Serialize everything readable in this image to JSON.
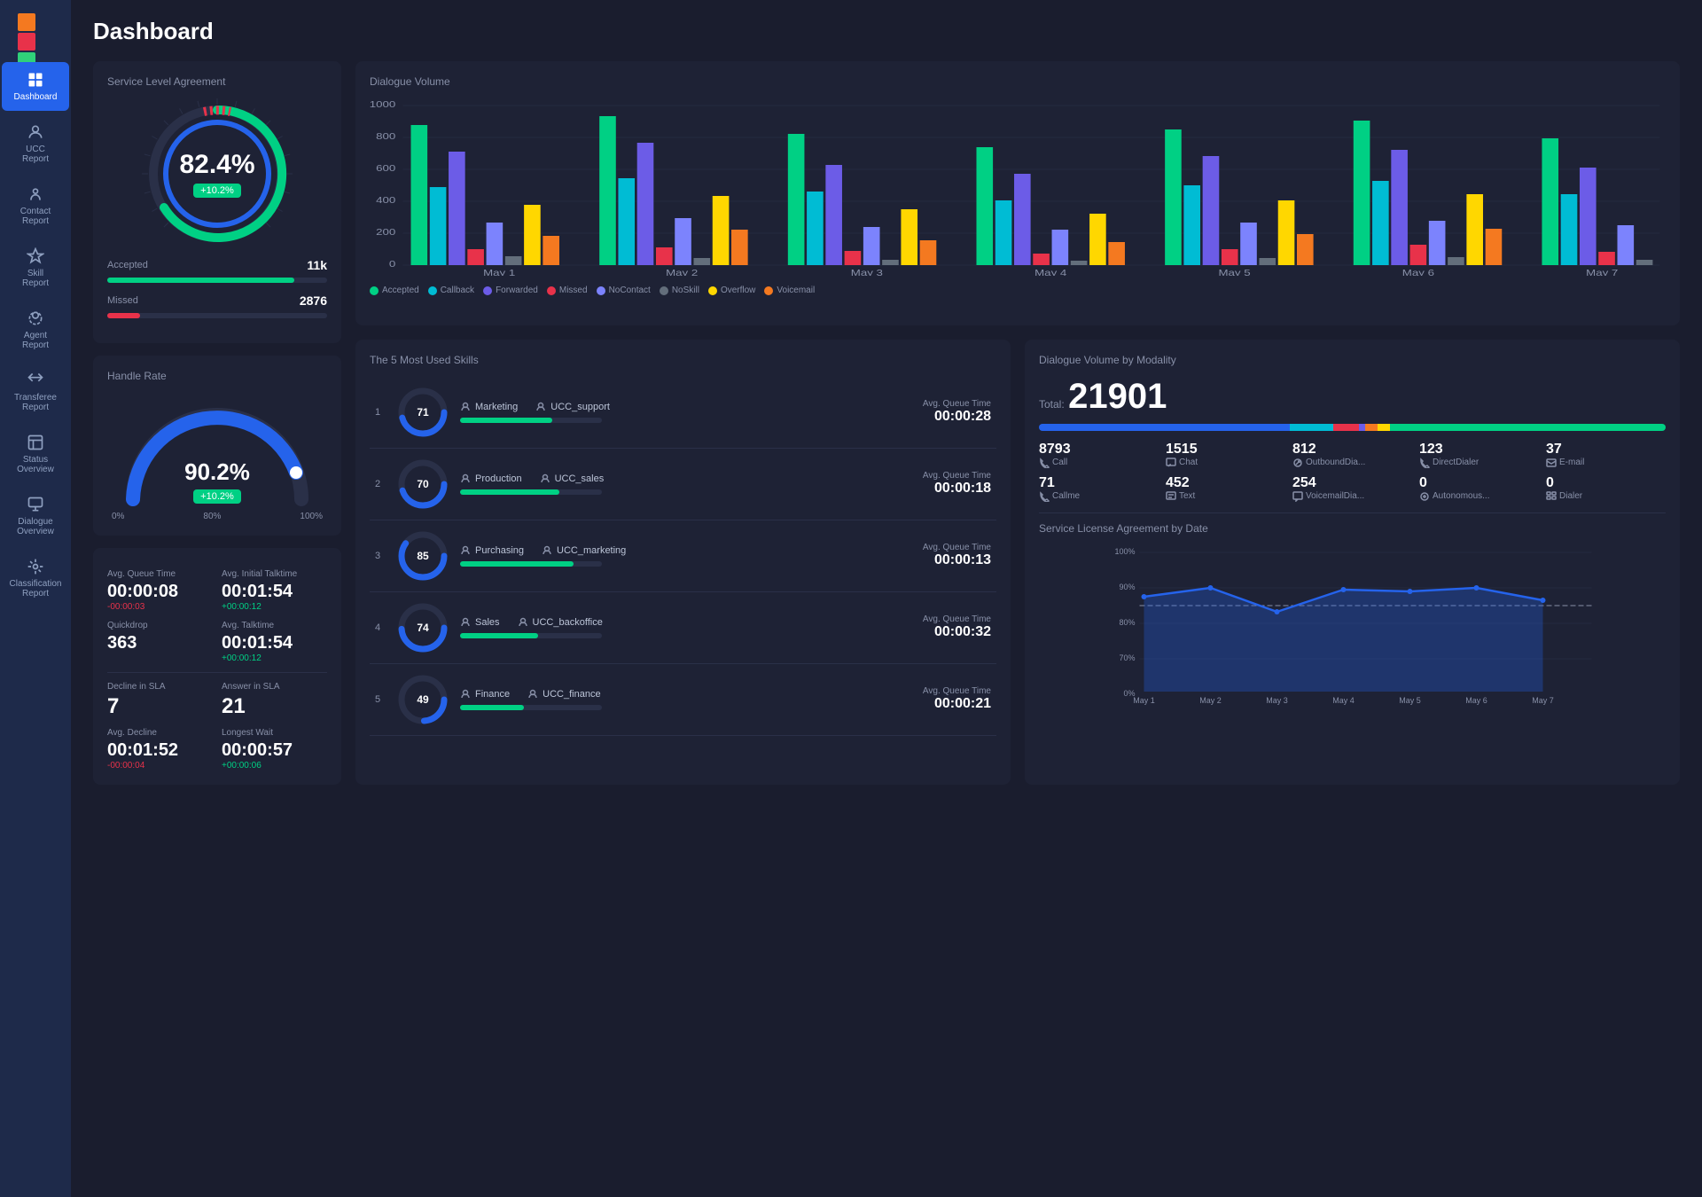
{
  "sidebar": {
    "logo": "dashboard-logo",
    "items": [
      {
        "id": "dashboard",
        "label": "Dashboard",
        "active": true
      },
      {
        "id": "ucc-report",
        "label": "UCC Report",
        "active": false
      },
      {
        "id": "contact-report",
        "label": "Contact Report",
        "active": false
      },
      {
        "id": "skill-report",
        "label": "Skill Report",
        "active": false
      },
      {
        "id": "agent-report",
        "label": "Agent Report",
        "active": false
      },
      {
        "id": "transferee-report",
        "label": "Transferee Report",
        "active": false
      },
      {
        "id": "status-overview",
        "label": "Status Overview",
        "active": false
      },
      {
        "id": "dialogue-overview",
        "label": "Dialogue Overview",
        "active": false
      },
      {
        "id": "classification-report",
        "label": "Classification Report",
        "active": false
      }
    ]
  },
  "header": {
    "title": "Dashboard"
  },
  "sla": {
    "title": "Service Level Agreement",
    "value": "82.4%",
    "badge": "+10.2%",
    "accepted_label": "Accepted",
    "accepted_value": "11k",
    "accepted_pct": 85,
    "missed_label": "Missed",
    "missed_value": "2876",
    "missed_pct": 15
  },
  "handle_rate": {
    "title": "Handle Rate",
    "value": "90.2%",
    "badge": "+10.2%",
    "min_label": "0%",
    "mid_label": "80%",
    "max_label": "100%",
    "pct": 90.2
  },
  "avg_stats": {
    "avg_queue_time_label": "Avg. Queue Time",
    "avg_queue_time_value": "00:00:08",
    "avg_queue_time_change": "-00:00:03",
    "avg_initial_talktime_label": "Avg. Initial Talktime",
    "avg_initial_talktime_value": "00:01:54",
    "avg_initial_talktime_change": "+00:00:12",
    "quickdrop_label": "Quickdrop",
    "quickdrop_value": "363",
    "avg_talktime_label": "Avg. Talktime",
    "avg_talktime_value": "00:01:54",
    "avg_talktime_change": "+00:00:12",
    "decline_sla_label": "Decline in SLA",
    "decline_sla_value": "7",
    "answer_sla_label": "Answer in SLA",
    "answer_sla_value": "21",
    "avg_decline_label": "Avg. Decline",
    "avg_decline_value": "00:01:52",
    "avg_decline_change": "-00:00:04",
    "longest_wait_label": "Longest Wait",
    "longest_wait_value": "00:00:57",
    "longest_wait_change": "+00:00:06"
  },
  "dialogue_volume": {
    "title": "Dialogue Volume",
    "y_labels": [
      "0",
      "200",
      "400",
      "600",
      "800",
      "1000"
    ],
    "x_labels": [
      "May 1",
      "May 2",
      "May 3",
      "May 4",
      "May 5",
      "May 6",
      "May 7"
    ],
    "legend": [
      {
        "label": "Accepted",
        "color": "#00d084"
      },
      {
        "label": "Callback",
        "color": "#00bcd4"
      },
      {
        "label": "Forwarded",
        "color": "#6c5ce7"
      },
      {
        "label": "Missed",
        "color": "#e8324a"
      },
      {
        "label": "NoContact",
        "color": "#7c83fd"
      },
      {
        "label": "NoSkill",
        "color": "#636e7b"
      },
      {
        "label": "Overflow",
        "color": "#ffd700"
      },
      {
        "label": "Voicemail",
        "color": "#f47920"
      }
    ]
  },
  "skills": {
    "title": "The 5 Most Used Skills",
    "items": [
      {
        "num": "1",
        "pct": 71,
        "skill1": "Marketing",
        "skill2": "UCC_support",
        "bar_pct": 65,
        "queue_time_label": "Avg. Queue Time",
        "queue_time": "00:00:28"
      },
      {
        "num": "2",
        "pct": 70,
        "skill1": "Production",
        "skill2": "UCC_sales",
        "bar_pct": 70,
        "queue_time_label": "Avg. Queue Time",
        "queue_time": "00:00:18"
      },
      {
        "num": "3",
        "pct": 85,
        "skill1": "Purchasing",
        "skill2": "UCC_marketing",
        "bar_pct": 80,
        "queue_time_label": "Avg. Queue Time",
        "queue_time": "00:00:13"
      },
      {
        "num": "4",
        "pct": 74,
        "skill1": "Sales",
        "skill2": "UCC_backoffice",
        "bar_pct": 55,
        "queue_time_label": "Avg. Queue Time",
        "queue_time": "00:00:32"
      },
      {
        "num": "5",
        "pct": 49,
        "skill1": "Finance",
        "skill2": "UCC_finance",
        "bar_pct": 45,
        "queue_time_label": "Avg. Queue Time",
        "queue_time": "00:00:21"
      }
    ]
  },
  "modality": {
    "title": "Dialogue Volume by Modality",
    "total_label": "Total:",
    "total_value": "21901",
    "bar_segments": [
      {
        "color": "#2563eb",
        "pct": 40
      },
      {
        "color": "#00bcd4",
        "pct": 7
      },
      {
        "color": "#e8324a",
        "pct": 4
      },
      {
        "color": "#6c5ce7",
        "pct": 1
      },
      {
        "color": "#f47920",
        "pct": 1
      },
      {
        "color": "#ffd700",
        "pct": 2
      },
      {
        "color": "#00d084",
        "pct": 45
      }
    ],
    "items": [
      {
        "value": "8793",
        "label": "Call",
        "icon": "phone"
      },
      {
        "value": "1515",
        "label": "Chat",
        "icon": "chat"
      },
      {
        "value": "812",
        "label": "OutboundDia...",
        "icon": "outbound"
      },
      {
        "value": "123",
        "label": "DirectDialer",
        "icon": "direct"
      },
      {
        "value": "37",
        "label": "E-mail",
        "icon": "email"
      },
      {
        "value": "71",
        "label": "Callme",
        "icon": "callme"
      },
      {
        "value": "452",
        "label": "Text",
        "icon": "text"
      },
      {
        "value": "254",
        "label": "VoicemailDia...",
        "icon": "voicemail"
      },
      {
        "value": "0",
        "label": "Autonomous...",
        "icon": "auto"
      },
      {
        "value": "0",
        "label": "Dialer",
        "icon": "dialer"
      }
    ]
  },
  "sla_by_date": {
    "title": "Service License Agreement by Date",
    "y_labels": [
      "0%",
      "70%",
      "80%",
      "90%",
      "100%"
    ],
    "x_labels": [
      "May 1",
      "May 2",
      "May 3",
      "May 4",
      "May 5",
      "May 6",
      "May 7"
    ],
    "target_pct": 85
  },
  "colors": {
    "accepted": "#00d084",
    "callback": "#00bcd4",
    "forwarded": "#6c5ce7",
    "missed": "#e8324a",
    "nocontact": "#7c83fd",
    "noskill": "#636e7b",
    "overflow": "#ffd700",
    "voicemail": "#f47920",
    "positive": "#00d084",
    "negative": "#e8324a",
    "primary": "#2563eb"
  }
}
